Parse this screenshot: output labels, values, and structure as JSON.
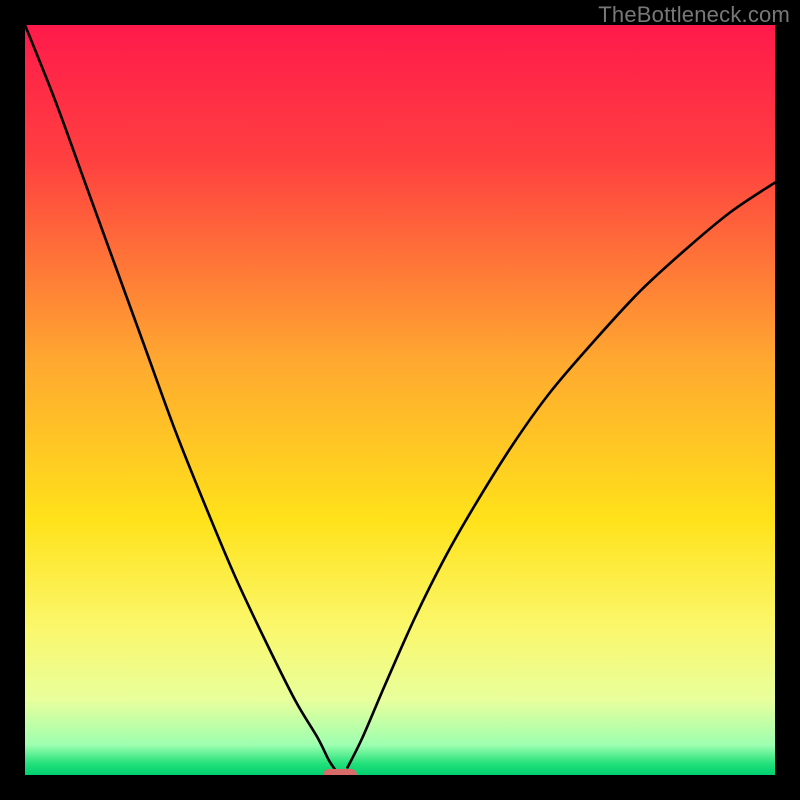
{
  "watermark": "TheBottleneck.com",
  "chart_data": {
    "type": "line",
    "title": "",
    "xlabel": "",
    "ylabel": "",
    "xlim": [
      0,
      100
    ],
    "ylim": [
      0,
      100
    ],
    "grid": false,
    "legend": false,
    "gradient_stops": [
      {
        "pct": 0,
        "color": "#ff1a4b"
      },
      {
        "pct": 18,
        "color": "#ff4040"
      },
      {
        "pct": 45,
        "color": "#ffa930"
      },
      {
        "pct": 66,
        "color": "#ffe21a"
      },
      {
        "pct": 80,
        "color": "#fbf76a"
      },
      {
        "pct": 90,
        "color": "#e8ff9c"
      },
      {
        "pct": 96,
        "color": "#9dffb0"
      },
      {
        "pct": 98.5,
        "color": "#22e07a"
      },
      {
        "pct": 100,
        "color": "#00d070"
      }
    ],
    "optimum_x": 42,
    "marker": {
      "x": 42,
      "y": 0,
      "width_pct": 4.5,
      "height_pct": 1.6
    },
    "series": [
      {
        "name": "left-branch",
        "x": [
          0,
          4,
          8,
          12,
          16,
          20,
          24,
          28,
          32,
          36,
          39,
          40.5,
          41.5
        ],
        "y": [
          100,
          90,
          79,
          68,
          57,
          46,
          36,
          26.5,
          18,
          10,
          5,
          2,
          0.5
        ]
      },
      {
        "name": "right-branch",
        "x": [
          43,
          45,
          48,
          52,
          56,
          60,
          65,
          70,
          76,
          82,
          88,
          94,
          100
        ],
        "y": [
          1,
          5,
          12,
          21,
          29,
          36,
          44,
          51,
          58,
          64.5,
          70,
          75,
          79
        ]
      }
    ]
  }
}
